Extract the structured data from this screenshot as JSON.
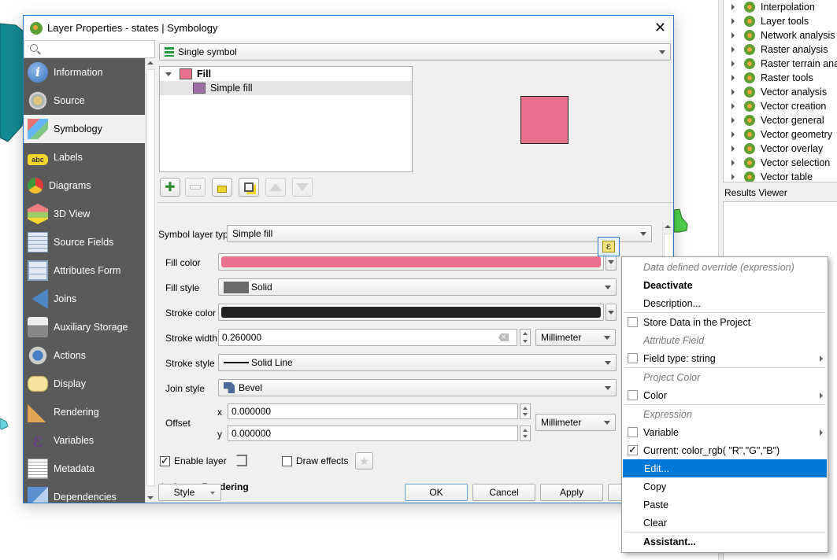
{
  "dialog": {
    "title": "Layer Properties - states | Symbology",
    "close_icon": "close-icon",
    "search_placeholder": ""
  },
  "sidebar": {
    "items": [
      {
        "label": "Information",
        "icon": "information-icon"
      },
      {
        "label": "Source",
        "icon": "source-icon"
      },
      {
        "label": "Symbology",
        "icon": "symbology-icon",
        "active": true
      },
      {
        "label": "Labels",
        "icon": "labels-icon"
      },
      {
        "label": "Diagrams",
        "icon": "diagrams-icon"
      },
      {
        "label": "3D View",
        "icon": "3d-view-icon"
      },
      {
        "label": "Source Fields",
        "icon": "source-fields-icon"
      },
      {
        "label": "Attributes Form",
        "icon": "attributes-form-icon"
      },
      {
        "label": "Joins",
        "icon": "joins-icon"
      },
      {
        "label": "Auxiliary Storage",
        "icon": "auxiliary-storage-icon"
      },
      {
        "label": "Actions",
        "icon": "actions-icon"
      },
      {
        "label": "Display",
        "icon": "display-icon"
      },
      {
        "label": "Rendering",
        "icon": "rendering-icon"
      },
      {
        "label": "Variables",
        "icon": "variables-icon"
      },
      {
        "label": "Metadata",
        "icon": "metadata-icon"
      },
      {
        "label": "Dependencies",
        "icon": "dependencies-icon"
      }
    ]
  },
  "symbology": {
    "renderer": "Single symbol",
    "tree": {
      "root": "Fill",
      "child": "Simple fill"
    },
    "symbol_layer_type_label": "Symbol layer type",
    "symbol_layer_type": "Simple fill",
    "fill_color_label": "Fill color",
    "fill_color": "#e8718b",
    "fill_style_label": "Fill style",
    "fill_style": "Solid",
    "stroke_color_label": "Stroke color",
    "stroke_color": "#222222",
    "stroke_width_label": "Stroke width",
    "stroke_width": "0.260000",
    "stroke_width_unit": "Millimeter",
    "stroke_style_label": "Stroke style",
    "stroke_style": "Solid Line",
    "join_style_label": "Join style",
    "join_style": "Bevel",
    "offset_label": "Offset",
    "offset_x_label": "x",
    "offset_x": "0.000000",
    "offset_y_label": "y",
    "offset_y": "0.000000",
    "offset_unit": "Millimeter",
    "enable_layer_label": "Enable layer",
    "enable_layer_checked": true,
    "draw_effects_label": "Draw effects",
    "draw_effects_checked": false,
    "layer_rendering_label": "Layer Rendering",
    "preview_color": "#e8718b"
  },
  "footer": {
    "style_label": "Style",
    "ok_label": "OK",
    "cancel_label": "Cancel",
    "apply_label": "Apply"
  },
  "context_menu": {
    "items": [
      {
        "type": "header",
        "label": "Data defined override (expression)"
      },
      {
        "type": "bold",
        "label": "Deactivate"
      },
      {
        "type": "item",
        "label": "Description..."
      },
      {
        "type": "sep"
      },
      {
        "type": "check",
        "label": "Store Data in the Project",
        "checked": false
      },
      {
        "type": "header",
        "label": "Attribute Field"
      },
      {
        "type": "check",
        "label": "Field type: string",
        "checked": false,
        "submenu": true
      },
      {
        "type": "sep"
      },
      {
        "type": "header",
        "label": "Project Color"
      },
      {
        "type": "check",
        "label": "Color",
        "checked": false,
        "submenu": true
      },
      {
        "type": "sep"
      },
      {
        "type": "header",
        "label": "Expression"
      },
      {
        "type": "check",
        "label": "Variable",
        "checked": false,
        "submenu": true
      },
      {
        "type": "check",
        "label": "Current: color_rgb( \"R\",\"G\",\"B\")",
        "checked": true
      },
      {
        "type": "highlight",
        "label": "Edit..."
      },
      {
        "type": "item",
        "label": "Copy"
      },
      {
        "type": "item",
        "label": "Paste"
      },
      {
        "type": "item",
        "label": "Clear"
      },
      {
        "type": "sep"
      },
      {
        "type": "bold",
        "label": "Assistant..."
      }
    ]
  },
  "processing": {
    "items": [
      "Interpolation",
      "Layer tools",
      "Network analysis",
      "Raster analysis",
      "Raster terrain analysis",
      "Raster tools",
      "Vector analysis",
      "Vector creation",
      "Vector general",
      "Vector geometry",
      "Vector overlay",
      "Vector selection",
      "Vector table"
    ],
    "results_viewer_label": "Results Viewer"
  }
}
